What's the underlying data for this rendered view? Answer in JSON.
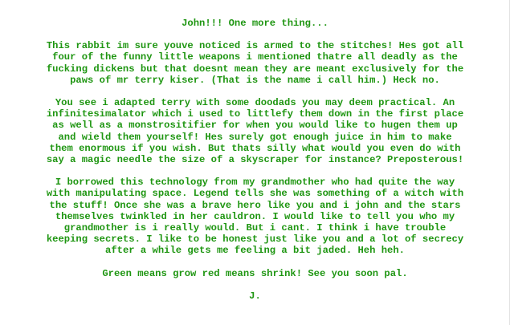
{
  "letter": {
    "greeting": "John!!! One more thing...",
    "paragraphs": [
      {
        "lines": [
          "This rabbit im sure youve noticed is armed to the stitches! Hes got all",
          "four of the funny little weapons i mentioned thatre all deadly as the",
          "fucking dickens but that doesnt mean they are meant exclusively for the",
          "paws of mr terry kiser. (That is the name i call him.) Heck no."
        ]
      },
      {
        "lines": [
          "You see i adapted terry with some doodads you may deem practical. An",
          "infinitesimalator which i used to littlefy them down in the first place",
          "as well as a monstrositifier for when you would like to hugen them up",
          "and wield them yourself! Hes surely got enough juice in him to make",
          "them enormous if you wish. But thats silly what would you even do with",
          "say a magic needle the size of a skyscraper for instance? Preposterous!"
        ]
      },
      {
        "lines": [
          "I borrowed this technology from my grandmother who had quite the way",
          "with manipulating space. Legend tells she was something of a witch with",
          "the stuff! Once she was a brave hero like you and i john and the stars",
          "themselves twinkled in her cauldron. I would like to tell you who my",
          "grandmother is i really would. But i cant. I think i have trouble",
          "keeping secrets. I like to be honest just like you and a lot of secrecy",
          "after a while gets me feeling a bit jaded. Heh heh."
        ]
      },
      {
        "lines": [
          "Green means grow red means shrink! See you soon pal."
        ]
      }
    ],
    "signature": "J."
  },
  "colors": {
    "text": "#1f9612",
    "background": "#ffffff"
  }
}
